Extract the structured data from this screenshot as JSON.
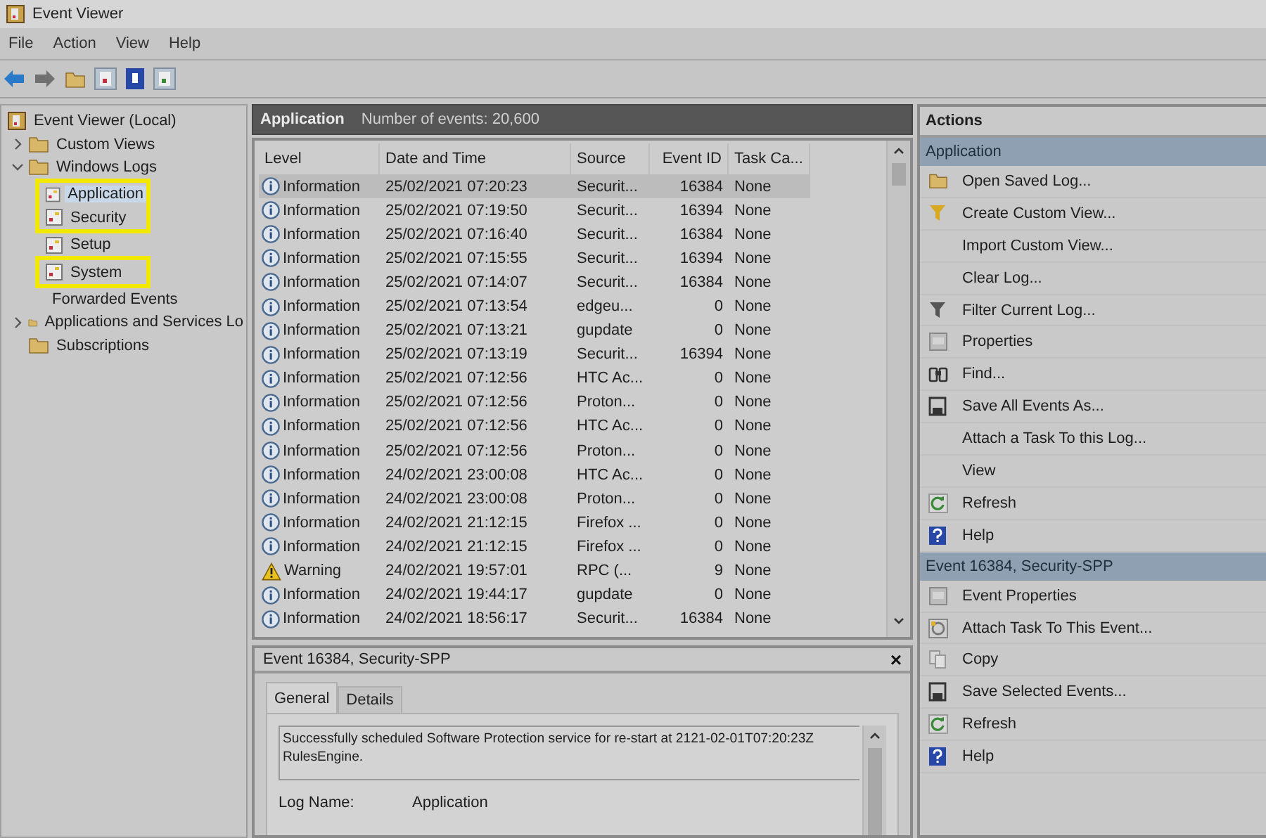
{
  "window": {
    "title": "Event Viewer"
  },
  "menu": [
    "File",
    "Action",
    "View",
    "Help"
  ],
  "tree": {
    "label": "Event Viewer (Local)",
    "children": [
      {
        "label": "Custom Views",
        "expanded": false
      },
      {
        "label": "Windows Logs",
        "expanded": true,
        "children": [
          {
            "label": "Application",
            "selected": true,
            "highlighted": true
          },
          {
            "label": "Security",
            "selected": false,
            "highlighted": true
          },
          {
            "label": "Setup",
            "selected": false,
            "highlighted": false
          },
          {
            "label": "System",
            "selected": false,
            "highlighted": true
          },
          {
            "label": "Forwarded Events",
            "selected": false,
            "highlighted": false
          }
        ]
      },
      {
        "label": "Applications and Services Lo",
        "expanded": false
      },
      {
        "label": "Subscriptions"
      }
    ]
  },
  "log_header": {
    "title": "Application",
    "count": "Number of events: 20,600"
  },
  "table": {
    "columns": [
      "Level",
      "Date and Time",
      "Source",
      "Event ID",
      "Task Ca..."
    ],
    "rows": [
      {
        "kind": "info",
        "level": "Information",
        "date": "25/02/2021 07:20:23",
        "source": "Securit...",
        "event_id": "16384",
        "task": "None",
        "selected": true
      },
      {
        "kind": "info",
        "level": "Information",
        "date": "25/02/2021 07:19:50",
        "source": "Securit...",
        "event_id": "16394",
        "task": "None",
        "selected": false
      },
      {
        "kind": "info",
        "level": "Information",
        "date": "25/02/2021 07:16:40",
        "source": "Securit...",
        "event_id": "16384",
        "task": "None",
        "selected": false
      },
      {
        "kind": "info",
        "level": "Information",
        "date": "25/02/2021 07:15:55",
        "source": "Securit...",
        "event_id": "16394",
        "task": "None",
        "selected": false
      },
      {
        "kind": "info",
        "level": "Information",
        "date": "25/02/2021 07:14:07",
        "source": "Securit...",
        "event_id": "16384",
        "task": "None",
        "selected": false
      },
      {
        "kind": "info",
        "level": "Information",
        "date": "25/02/2021 07:13:54",
        "source": "edgeu...",
        "event_id": "0",
        "task": "None",
        "selected": false
      },
      {
        "kind": "info",
        "level": "Information",
        "date": "25/02/2021 07:13:21",
        "source": "gupdate",
        "event_id": "0",
        "task": "None",
        "selected": false
      },
      {
        "kind": "info",
        "level": "Information",
        "date": "25/02/2021 07:13:19",
        "source": "Securit...",
        "event_id": "16394",
        "task": "None",
        "selected": false
      },
      {
        "kind": "info",
        "level": "Information",
        "date": "25/02/2021 07:12:56",
        "source": "HTC Ac...",
        "event_id": "0",
        "task": "None",
        "selected": false
      },
      {
        "kind": "info",
        "level": "Information",
        "date": "25/02/2021 07:12:56",
        "source": "Proton...",
        "event_id": "0",
        "task": "None",
        "selected": false
      },
      {
        "kind": "info",
        "level": "Information",
        "date": "25/02/2021 07:12:56",
        "source": "HTC Ac...",
        "event_id": "0",
        "task": "None",
        "selected": false
      },
      {
        "kind": "info",
        "level": "Information",
        "date": "25/02/2021 07:12:56",
        "source": "Proton...",
        "event_id": "0",
        "task": "None",
        "selected": false
      },
      {
        "kind": "info",
        "level": "Information",
        "date": "24/02/2021 23:00:08",
        "source": "HTC Ac...",
        "event_id": "0",
        "task": "None",
        "selected": false
      },
      {
        "kind": "info",
        "level": "Information",
        "date": "24/02/2021 23:00:08",
        "source": "Proton...",
        "event_id": "0",
        "task": "None",
        "selected": false
      },
      {
        "kind": "info",
        "level": "Information",
        "date": "24/02/2021 21:12:15",
        "source": "Firefox ...",
        "event_id": "0",
        "task": "None",
        "selected": false
      },
      {
        "kind": "info",
        "level": "Information",
        "date": "24/02/2021 21:12:15",
        "source": "Firefox ...",
        "event_id": "0",
        "task": "None",
        "selected": false
      },
      {
        "kind": "warning",
        "level": "Warning",
        "date": "24/02/2021 19:57:01",
        "source": "RPC (...",
        "event_id": "9",
        "task": "None",
        "selected": false
      },
      {
        "kind": "info",
        "level": "Information",
        "date": "24/02/2021 19:44:17",
        "source": "gupdate",
        "event_id": "0",
        "task": "None",
        "selected": false
      },
      {
        "kind": "info",
        "level": "Information",
        "date": "24/02/2021 18:56:17",
        "source": "Securit...",
        "event_id": "16384",
        "task": "None",
        "selected": false
      }
    ]
  },
  "detail": {
    "title": "Event 16384, Security-SPP",
    "close": "×",
    "tabs": [
      {
        "label": "General",
        "selected": true
      },
      {
        "label": "Details",
        "selected": false
      }
    ],
    "message": "Successfully scheduled Software Protection service for re-start at 2121-02-01T07:20:23Z\nRulesEngine.",
    "fields": [
      {
        "label": "Log Name:",
        "value": "Application"
      }
    ]
  },
  "actions": {
    "title": "Actions",
    "sections": [
      {
        "title": "Application",
        "items": [
          "Open Saved Log...",
          "Create Custom View...",
          "Import Custom View...",
          "Clear Log...",
          "Filter Current Log...",
          "Properties",
          "Find...",
          "Save All Events As...",
          "Attach a Task To this Log...",
          "View",
          "Refresh",
          "Help"
        ]
      },
      {
        "title": "Event 16384, Security-SPP",
        "items": [
          "Event Properties",
          "Attach Task To This Event...",
          "Copy",
          "Save Selected Events...",
          "Refresh",
          "Help"
        ]
      }
    ]
  }
}
